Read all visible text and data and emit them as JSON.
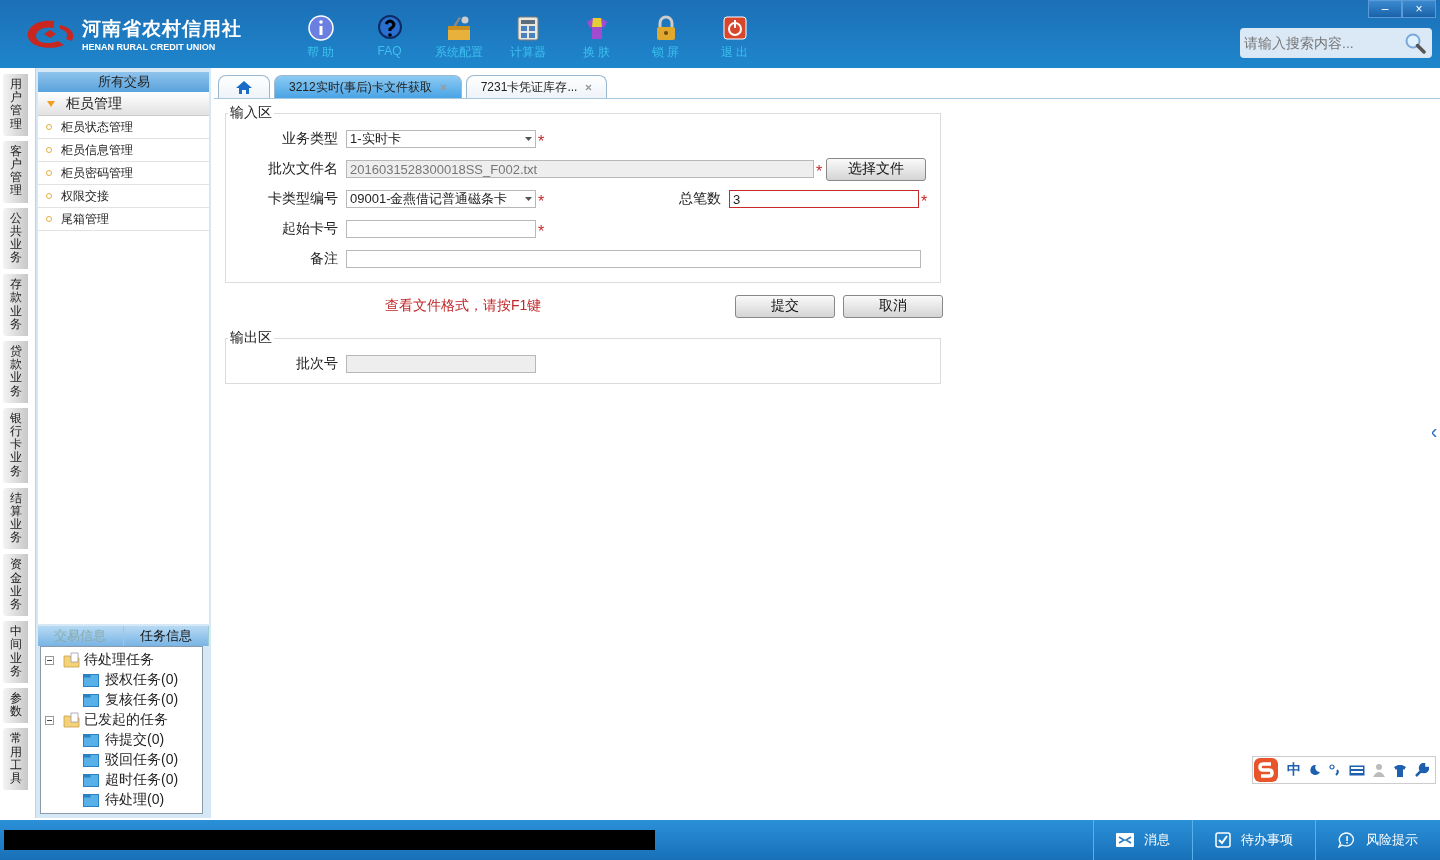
{
  "header": {
    "logo_cn": "河南省农村信用社",
    "logo_en": "HENAN RURAL CREDIT UNION",
    "toolbar": [
      {
        "label": "帮 助",
        "kind": "info"
      },
      {
        "label": "FAQ",
        "kind": "faq"
      },
      {
        "label": "系统配置",
        "kind": "config"
      },
      {
        "label": "计算器",
        "kind": "calc"
      },
      {
        "label": "换 肤",
        "kind": "skin"
      },
      {
        "label": "锁 屏",
        "kind": "lock"
      },
      {
        "label": "退 出",
        "kind": "exit"
      }
    ],
    "search": {
      "placeholder": "请输入搜索内容..."
    },
    "window_controls": [
      "–",
      "×"
    ]
  },
  "left_tabs": [
    "用户管理",
    "客户管理",
    "公共业务",
    "存款业务",
    "贷款业务",
    "银行卡业务",
    "结算业务",
    "资金业务",
    "中间业务",
    "参数",
    "常用工具"
  ],
  "sidebar": {
    "title": "所有交易",
    "group": {
      "label": "柜员管理",
      "expanded": true,
      "items": [
        "柜员状态管理",
        "柜员信息管理",
        "柜员密码管理",
        "权限交接",
        "尾箱管理"
      ]
    }
  },
  "task_panel": {
    "tabs": [
      {
        "label": "交易信息",
        "selected": false
      },
      {
        "label": "任务信息",
        "selected": true
      }
    ],
    "tree": [
      {
        "label": "待处理任务",
        "expanded": true,
        "children": [
          {
            "label": "授权任务(0)"
          },
          {
            "label": "复核任务(0)"
          }
        ]
      },
      {
        "label": "已发起的任务",
        "expanded": true,
        "children": [
          {
            "label": "待提交(0)"
          },
          {
            "label": "驳回任务(0)"
          },
          {
            "label": "超时任务(0)"
          },
          {
            "label": "待处理(0)"
          }
        ]
      }
    ]
  },
  "tabs": [
    {
      "kind": "home",
      "selected": false
    },
    {
      "kind": "page",
      "label": "3212实时(事后)卡文件获取",
      "selected": true
    },
    {
      "kind": "page",
      "label": "7231卡凭证库存...",
      "selected": false
    }
  ],
  "input_section": {
    "title": "输入区",
    "rows": [
      [
        {
          "label": "业务类型",
          "kind": "select",
          "value": "1-实时卡",
          "required_mark": "*",
          "invalid": false,
          "disabled": false
        }
      ],
      [
        {
          "label": "批次文件名",
          "kind": "file",
          "value": "2016031528300018SS_F002.txt",
          "required_mark": "*",
          "invalid": false,
          "disabled": true,
          "button": "选择文件"
        }
      ],
      [
        {
          "label": "卡类型编号",
          "kind": "select",
          "value": "09001-金燕借记普通磁条卡",
          "required_mark": "*",
          "invalid": false,
          "disabled": false
        },
        {
          "label": "总笔数",
          "kind": "text",
          "value": "3",
          "required_mark": "*",
          "invalid": true,
          "disabled": false
        }
      ],
      [
        {
          "label": "起始卡号",
          "kind": "text",
          "required_mark": "*",
          "invalid": false,
          "disabled": false
        }
      ],
      [
        {
          "label": "备注",
          "kind": "text",
          "invalid": false,
          "disabled": false
        }
      ]
    ]
  },
  "hint": "查看文件格式，请按F1键",
  "buttons": [
    "提交",
    "取消"
  ],
  "output_section": {
    "title": "输出区",
    "rows": [
      [
        {
          "label": "批次号",
          "invalid": false,
          "disabled": true
        }
      ]
    ]
  },
  "ime_toolbar": {
    "mode": "中"
  },
  "status_bar": [
    {
      "label": "消息",
      "kind": "mail"
    },
    {
      "label": "待办事项",
      "kind": "todo"
    },
    {
      "label": "风险提示",
      "kind": "risk"
    }
  ]
}
